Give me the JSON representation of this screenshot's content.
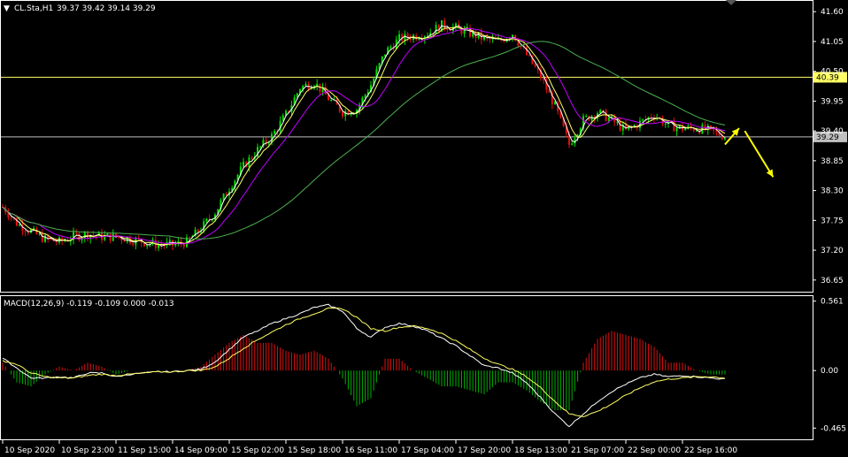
{
  "header": {
    "symbol": "CL.Sta,H1",
    "ohlc": "39.37 39.42 39.14 39.29"
  },
  "macd_header": "MACD(12,26,9) -0.119 -0.109 0.000 -0.013",
  "colors": {
    "background": "#000000",
    "frame": "#ffffff",
    "bull": "#00e000",
    "bear": "#e01010",
    "ma_fast": "#ffffff",
    "ma_mid": "#ffff66",
    "ma_slow_purple": "#c000ff",
    "ma_long_green": "#4caf50",
    "level_line": "#ffff66",
    "price_line": "#c0c0c0",
    "arrow": "#ffff00",
    "macd_line": "#ffffff",
    "signal_line": "#ffff66",
    "hist_pos": "#e01010",
    "hist_neg": "#00b000"
  },
  "chart_data": [
    {
      "type": "candlestick",
      "panel": "price",
      "ylim": [
        36.5,
        41.75
      ],
      "y_ticks": [
        "41.60",
        "41.05",
        "40.50",
        "39.95",
        "39.40",
        "38.85",
        "38.30",
        "37.75",
        "37.20",
        "36.65"
      ],
      "x_ticks": [
        "10 Sep 2020",
        "10 Sep 23:00",
        "11 Sep 15:00",
        "14 Sep 09:00",
        "15 Sep 02:00",
        "15 Sep 18:00",
        "16 Sep 11:00",
        "17 Sep 04:00",
        "17 Sep 20:00",
        "18 Sep 13:00",
        "21 Sep 07:00",
        "22 Sep 00:00",
        "22 Sep 16:00"
      ],
      "level_lines": [
        {
          "value": 40.39,
          "label": "40.39"
        },
        {
          "value": 39.29,
          "label": "39.29"
        }
      ],
      "close_path": [
        [
          0,
          38.0
        ],
        [
          5,
          37.7
        ],
        [
          10,
          37.55
        ],
        [
          15,
          37.4
        ],
        [
          20,
          37.35
        ],
        [
          25,
          37.45
        ],
        [
          30,
          37.5
        ],
        [
          35,
          37.45
        ],
        [
          40,
          37.45
        ],
        [
          45,
          37.4
        ],
        [
          50,
          37.35
        ],
        [
          55,
          37.3
        ],
        [
          60,
          37.3
        ],
        [
          65,
          37.35
        ],
        [
          70,
          37.6
        ],
        [
          75,
          37.9
        ],
        [
          80,
          38.35
        ],
        [
          85,
          38.75
        ],
        [
          90,
          39.05
        ],
        [
          95,
          39.3
        ],
        [
          100,
          39.7
        ],
        [
          105,
          40.2
        ],
        [
          110,
          40.3
        ],
        [
          115,
          40.0
        ],
        [
          120,
          39.75
        ],
        [
          125,
          39.8
        ],
        [
          130,
          40.25
        ],
        [
          135,
          40.85
        ],
        [
          140,
          41.1
        ],
        [
          145,
          41.15
        ],
        [
          150,
          41.2
        ],
        [
          155,
          41.35
        ],
        [
          160,
          41.3
        ],
        [
          165,
          41.2
        ],
        [
          170,
          41.1
        ],
        [
          175,
          41.05
        ],
        [
          180,
          41.2
        ],
        [
          185,
          40.8
        ],
        [
          190,
          40.4
        ],
        [
          195,
          39.85
        ],
        [
          200,
          39.15
        ],
        [
          205,
          39.6
        ],
        [
          210,
          39.75
        ],
        [
          215,
          39.6
        ],
        [
          220,
          39.4
        ],
        [
          225,
          39.55
        ],
        [
          230,
          39.7
        ],
        [
          235,
          39.5
        ],
        [
          240,
          39.45
        ],
        [
          245,
          39.45
        ],
        [
          250,
          39.4
        ],
        [
          255,
          39.3
        ]
      ],
      "projection_arrows": [
        {
          "from": [
            255,
            39.15
          ],
          "to": [
            260,
            39.45
          ]
        },
        {
          "from": [
            262,
            39.4
          ],
          "to": [
            272,
            38.55
          ]
        }
      ]
    },
    {
      "type": "macd",
      "panel": "macd",
      "ylim": [
        -0.52,
        0.58
      ],
      "y_ticks": [
        "0.561",
        "0.00",
        "-0.465"
      ],
      "macd_path": [
        [
          0,
          0.1
        ],
        [
          5,
          0.02
        ],
        [
          10,
          -0.06
        ],
        [
          15,
          -0.06
        ],
        [
          20,
          -0.05
        ],
        [
          25,
          -0.06
        ],
        [
          30,
          -0.02
        ],
        [
          35,
          -0.02
        ],
        [
          40,
          -0.05
        ],
        [
          45,
          -0.03
        ],
        [
          50,
          -0.02
        ],
        [
          55,
          -0.01
        ],
        [
          60,
          -0.01
        ],
        [
          65,
          0.0
        ],
        [
          70,
          0.01
        ],
        [
          75,
          0.07
        ],
        [
          80,
          0.17
        ],
        [
          85,
          0.27
        ],
        [
          90,
          0.32
        ],
        [
          95,
          0.38
        ],
        [
          100,
          0.42
        ],
        [
          105,
          0.46
        ],
        [
          110,
          0.51
        ],
        [
          115,
          0.53
        ],
        [
          120,
          0.48
        ],
        [
          125,
          0.34
        ],
        [
          130,
          0.27
        ],
        [
          135,
          0.35
        ],
        [
          140,
          0.38
        ],
        [
          145,
          0.36
        ],
        [
          150,
          0.32
        ],
        [
          155,
          0.26
        ],
        [
          160,
          0.2
        ],
        [
          165,
          0.12
        ],
        [
          170,
          0.04
        ],
        [
          175,
          0.02
        ],
        [
          180,
          -0.02
        ],
        [
          185,
          -0.1
        ],
        [
          190,
          -0.22
        ],
        [
          195,
          -0.35
        ],
        [
          200,
          -0.45
        ],
        [
          205,
          -0.35
        ],
        [
          210,
          -0.25
        ],
        [
          215,
          -0.17
        ],
        [
          220,
          -0.11
        ],
        [
          225,
          -0.06
        ],
        [
          230,
          -0.03
        ],
        [
          235,
          -0.05
        ],
        [
          240,
          -0.04
        ],
        [
          245,
          -0.05
        ],
        [
          250,
          -0.06
        ],
        [
          255,
          -0.07
        ]
      ],
      "signal_path": [
        [
          0,
          0.08
        ],
        [
          5,
          0.05
        ],
        [
          10,
          -0.02
        ],
        [
          15,
          -0.05
        ],
        [
          20,
          -0.06
        ],
        [
          25,
          -0.06
        ],
        [
          30,
          -0.04
        ],
        [
          35,
          -0.03
        ],
        [
          40,
          -0.04
        ],
        [
          45,
          -0.03
        ],
        [
          50,
          -0.02
        ],
        [
          55,
          -0.01
        ],
        [
          60,
          -0.01
        ],
        [
          65,
          0.0
        ],
        [
          70,
          0.0
        ],
        [
          75,
          0.03
        ],
        [
          80,
          0.1
        ],
        [
          85,
          0.18
        ],
        [
          90,
          0.25
        ],
        [
          95,
          0.31
        ],
        [
          100,
          0.37
        ],
        [
          105,
          0.42
        ],
        [
          110,
          0.46
        ],
        [
          115,
          0.5
        ],
        [
          120,
          0.5
        ],
        [
          125,
          0.43
        ],
        [
          130,
          0.34
        ],
        [
          135,
          0.32
        ],
        [
          140,
          0.35
        ],
        [
          145,
          0.36
        ],
        [
          150,
          0.34
        ],
        [
          155,
          0.3
        ],
        [
          160,
          0.24
        ],
        [
          165,
          0.17
        ],
        [
          170,
          0.1
        ],
        [
          175,
          0.05
        ],
        [
          180,
          0.01
        ],
        [
          185,
          -0.05
        ],
        [
          190,
          -0.14
        ],
        [
          195,
          -0.25
        ],
        [
          200,
          -0.35
        ],
        [
          205,
          -0.37
        ],
        [
          210,
          -0.33
        ],
        [
          215,
          -0.27
        ],
        [
          220,
          -0.2
        ],
        [
          225,
          -0.14
        ],
        [
          230,
          -0.09
        ],
        [
          235,
          -0.07
        ],
        [
          240,
          -0.06
        ],
        [
          245,
          -0.05
        ],
        [
          250,
          -0.05
        ],
        [
          255,
          -0.06
        ]
      ]
    }
  ]
}
